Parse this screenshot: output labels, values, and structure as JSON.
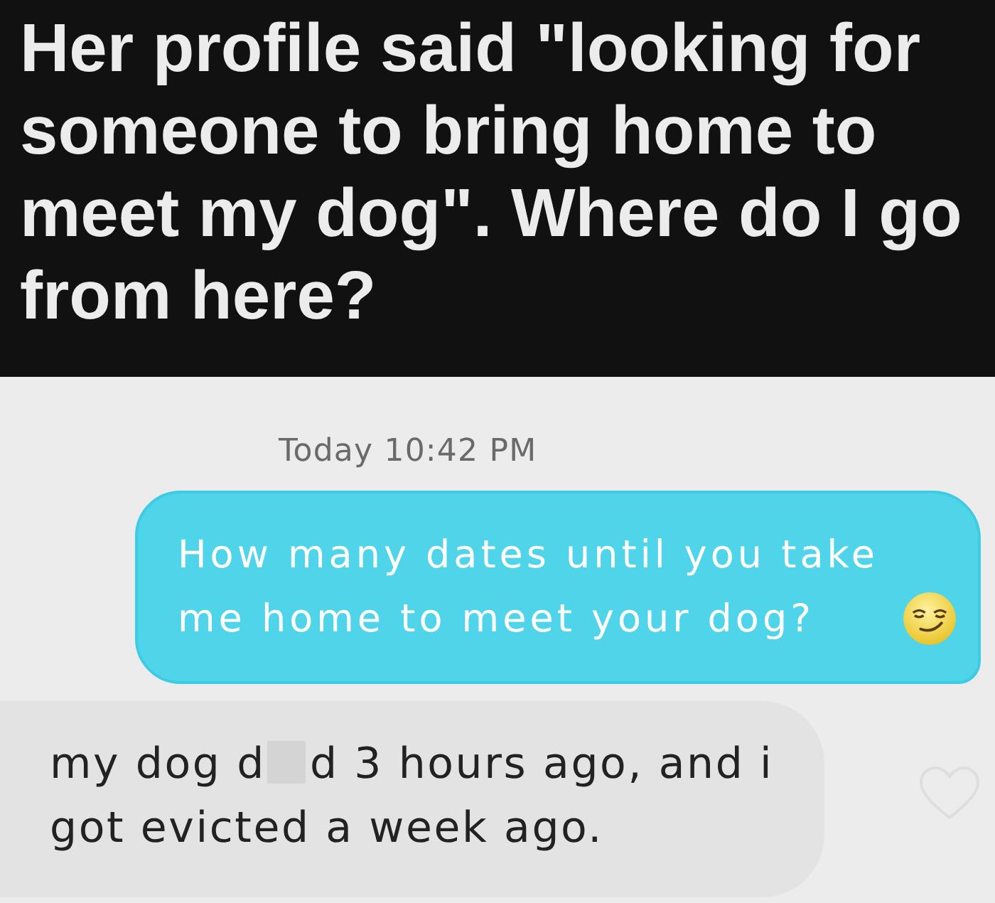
{
  "post": {
    "title": "Her profile said \"looking for someone to bring home to meet my dog\". Where do I go from here?"
  },
  "chat": {
    "timestamp": "Today 10:42 PM",
    "messages": [
      {
        "kind": "sent",
        "text": "How many dates until you take me home to meet your dog?",
        "emoji": true
      },
      {
        "kind": "received",
        "text_before": "my dog d",
        "censored": true,
        "text_after": "d 3 hours ago, and i got evicted a week ago.",
        "liked": false
      }
    ]
  }
}
